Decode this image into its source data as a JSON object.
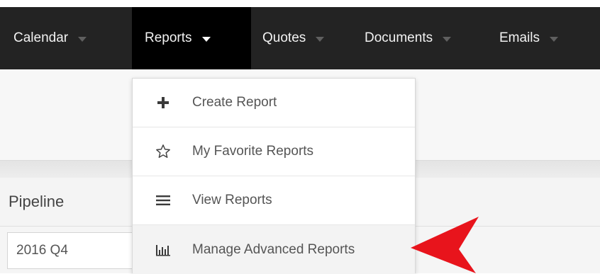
{
  "nav": {
    "items": [
      {
        "label": "Calendar",
        "active": false
      },
      {
        "label": "Reports",
        "active": true
      },
      {
        "label": "Quotes",
        "active": false
      },
      {
        "label": "Documents",
        "active": false
      },
      {
        "label": "Emails",
        "active": false
      }
    ]
  },
  "dropdown": {
    "items": [
      {
        "label": "Create Report",
        "icon": "plus-icon"
      },
      {
        "label": "My Favorite Reports",
        "icon": "star-icon"
      },
      {
        "label": "View Reports",
        "icon": "list-icon"
      },
      {
        "label": "Manage Advanced Reports",
        "icon": "bar-chart-icon"
      }
    ]
  },
  "page": {
    "pipeline_label": "Pipeline",
    "period_value": "2016 Q4"
  },
  "colors": {
    "navbar": "#232323",
    "nav_active": "#000000",
    "arrow": "#e8141c"
  }
}
